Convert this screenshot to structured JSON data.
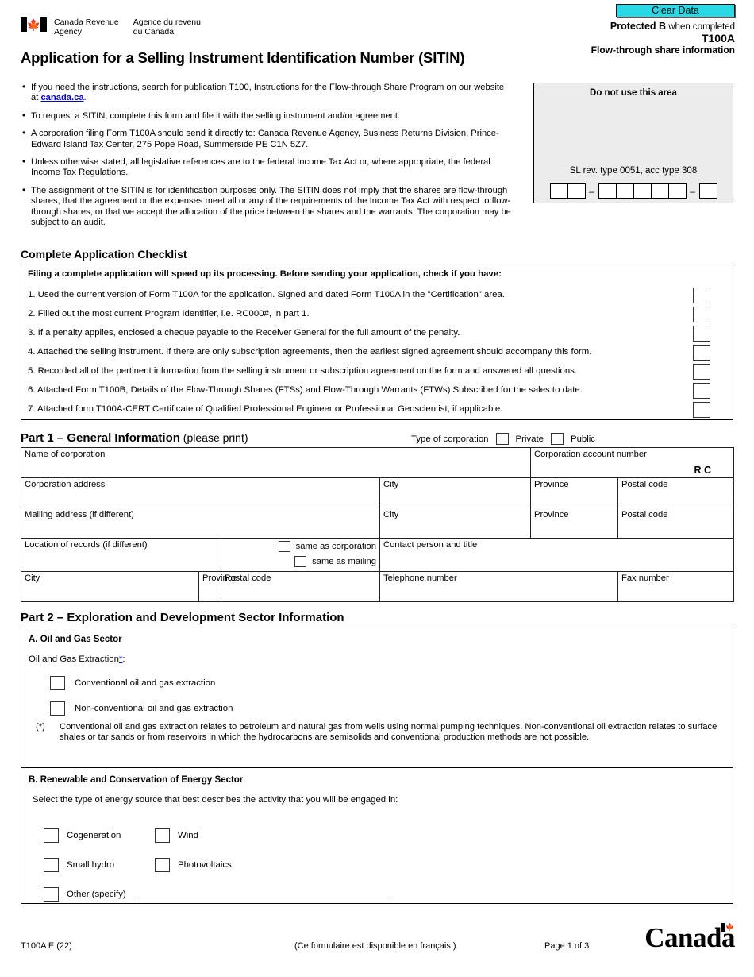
{
  "toolbar": {
    "clear_data_label": "Clear Data"
  },
  "header": {
    "agency_en": "Canada Revenue\nAgency",
    "agency_fr": "Agence du revenu\ndu Canada",
    "protected_bold": "Protected B",
    "protected_rest": " when completed",
    "form_code": "T100A",
    "form_subtitle": "Flow-through share information",
    "title": "Application for a Selling Instrument Identification Number (SITIN)"
  },
  "intro_bullets": [
    {
      "pre": "If you need the instructions, search for publication T100, Instructions for the Flow-through Share Program on our website at ",
      "link": "canada.ca",
      "post": "."
    },
    {
      "pre": "To request a SITIN, complete this form and file it with the selling instrument and/or agreement.",
      "link": "",
      "post": ""
    },
    {
      "pre": "A corporation filing Form T100A should send it directly to: Canada Revenue Agency, Business Returns Division, Prince-Edward Island Tax Center, 275 Pope Road, Summerside PE  C1N 5Z7.",
      "link": "",
      "post": ""
    },
    {
      "pre": "Unless otherwise stated, all legislative references are to the federal Income Tax Act or, where appropriate, the federal Income Tax Regulations.",
      "link": "",
      "post": ""
    },
    {
      "pre": "The assignment of the SITIN is for identification purposes only. The SITIN does not imply that the shares are flow-through shares, that the agreement or the expenses meet all or any of the requirements of the Income Tax Act with respect to flow-through shares, or that we accept the allocation of the price between the shares and the warrants. The corporation may be subject to an audit.",
      "link": "",
      "post": ""
    }
  ],
  "do_not_use": {
    "title": "Do not use this area",
    "sl_line": "SL rev. type 0051, acc type 308",
    "group1_cells": 2,
    "group2_cells": 5,
    "group3_cells": 1,
    "separator": "–"
  },
  "checklist": {
    "heading": "Complete Application Checklist",
    "lead": "Filing a complete application will speed up its processing. Before sending your application, check if you have:",
    "items": [
      "1. Used the current version of Form T100A for the application. Signed and dated Form T100A in the \"Certification\" area.",
      "2. Filled out the most current Program Identifier, i.e. RC000#, in part 1.",
      "3. If a penalty applies, enclosed a cheque payable to the Receiver General for the full amount of the penalty.",
      "4. Attached the selling instrument. If there are only subscription agreements, then the earliest signed agreement should accompany this form.",
      "5. Recorded all of the pertinent information from the selling instrument or subscription agreement on the form and answered all questions.",
      "6. Attached Form T100B, Details of the Flow-Through Shares (FTSs) and Flow-Through Warrants (FTWs) Subscribed for the sales to date.",
      "7. Attached form T100A-CERT Certificate of Qualified Professional Engineer or Professional Geoscientist, if applicable."
    ]
  },
  "part1": {
    "heading_part": "Part 1",
    "heading_dash": " – ",
    "heading_name": "General Information",
    "heading_note": " (please print)",
    "type_of_corporation_label": "Type of corporation",
    "private_label": "Private",
    "public_label": "Public",
    "fields": {
      "name_of_corporation": "Name of corporation",
      "corporation_account_number": "Corporation account number",
      "rc": "R C",
      "corporation_address": "Corporation address",
      "city": "City",
      "province": "Province",
      "postal_code": "Postal code",
      "mailing_address": "Mailing address (if different)",
      "location_of_records": "Location of records (if different)",
      "same_as_corporation": "same as corporation",
      "same_as_mailing": "same as mailing",
      "contact_person": "Contact person and title",
      "telephone_number": "Telephone number",
      "fax_number": "Fax number"
    }
  },
  "part2": {
    "heading": "Part 2 – Exploration and Development Sector Information",
    "sectionA": {
      "heading": "A. Oil and Gas Sector",
      "question_pre": "Oil and Gas Extraction",
      "question_ast": "*",
      "question_post": ":",
      "options": [
        "Conventional oil and gas extraction",
        "Non-conventional oil and gas extraction"
      ],
      "footnote_mark": "(*)",
      "footnote_text": "Conventional oil and gas extraction relates to petroleum and natural gas from wells using normal pumping techniques. Non-conventional oil extraction relates to surface shales or tar sands or from reservoirs in which the hydrocarbons are semisolids and conventional production methods are not possible."
    },
    "sectionB": {
      "heading": "B. Renewable and Conservation of Energy Sector",
      "question": "Select the type of energy source that best describes the activity that you will be engaged in:",
      "options_col1": [
        "Cogeneration",
        "Small hydro",
        "Other (specify)"
      ],
      "options_col2": [
        "Wind",
        "Photovoltaics"
      ]
    }
  },
  "footer": {
    "form_id": "T100A E (22)",
    "french_note": "(Ce formulaire est disponible en français.)",
    "page": "Page 1 of 3",
    "wordmark": "Canada"
  },
  "colors": {
    "clear_data_bg": "#2ad8e6",
    "link": "#0000cc",
    "panel_bg": "#ececec"
  }
}
